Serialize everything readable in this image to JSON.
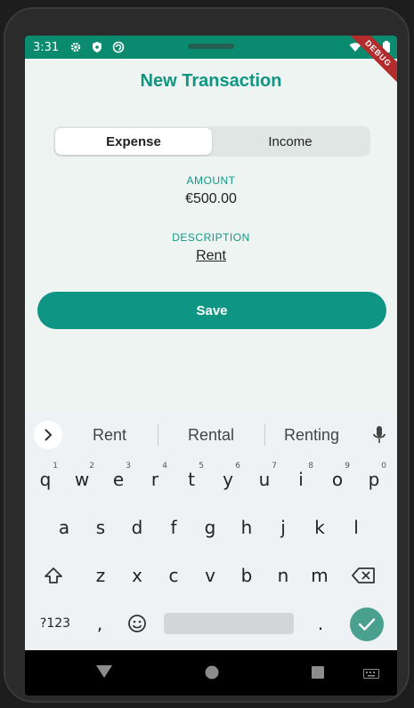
{
  "status_bar": {
    "time": "3:31"
  },
  "debug_banner": "DEBUG",
  "app": {
    "title": "New Transaction",
    "type_toggle": {
      "options": [
        "Expense",
        "Income"
      ],
      "selected": "Expense"
    },
    "amount": {
      "label": "AMOUNT",
      "value": "€500.00"
    },
    "description": {
      "label": "DESCRIPTION",
      "value": "Rent"
    },
    "save_label": "Save"
  },
  "keyboard": {
    "suggestions": [
      "Rent",
      "Rental",
      "Renting"
    ],
    "row1": [
      "q",
      "w",
      "e",
      "r",
      "t",
      "y",
      "u",
      "i",
      "o",
      "p"
    ],
    "row1_numbers": [
      "1",
      "2",
      "3",
      "4",
      "5",
      "6",
      "7",
      "8",
      "9",
      "0"
    ],
    "row2": [
      "a",
      "s",
      "d",
      "f",
      "g",
      "h",
      "j",
      "k",
      "l"
    ],
    "row3": [
      "z",
      "x",
      "c",
      "v",
      "b",
      "n",
      "m"
    ],
    "symbols_label": "?123",
    "comma": ",",
    "period": "."
  },
  "colors": {
    "accent": "#0e9583",
    "status_bar": "#0a8a6e",
    "background": "#eef4f1",
    "debug": "#b42b2b"
  }
}
